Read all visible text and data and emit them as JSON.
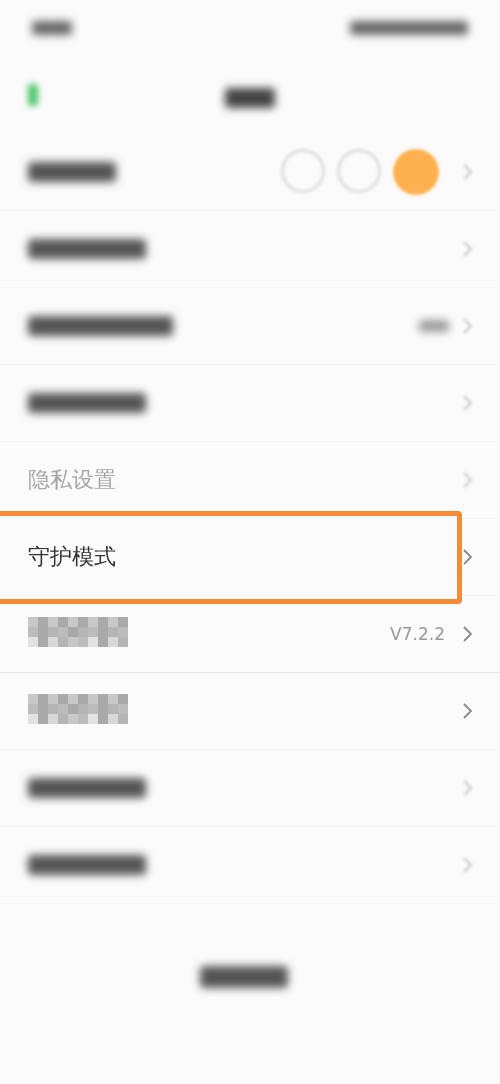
{
  "rows": [
    {
      "kind": "avatars",
      "highlighted": false
    },
    {
      "kind": "blurred",
      "highlighted": false
    },
    {
      "kind": "blurred_value",
      "highlighted": false
    },
    {
      "kind": "blurred",
      "highlighted": false
    },
    {
      "kind": "label",
      "label": "隐私设置",
      "faded": true,
      "highlighted": false
    },
    {
      "kind": "label",
      "label": "守护模式",
      "faded": false,
      "highlighted": true
    },
    {
      "kind": "masked",
      "value": "V7.2.2",
      "highlighted": false
    },
    {
      "kind": "masked",
      "highlighted": false
    },
    {
      "kind": "blurred",
      "highlighted": false
    },
    {
      "kind": "blurred",
      "highlighted": false
    }
  ]
}
